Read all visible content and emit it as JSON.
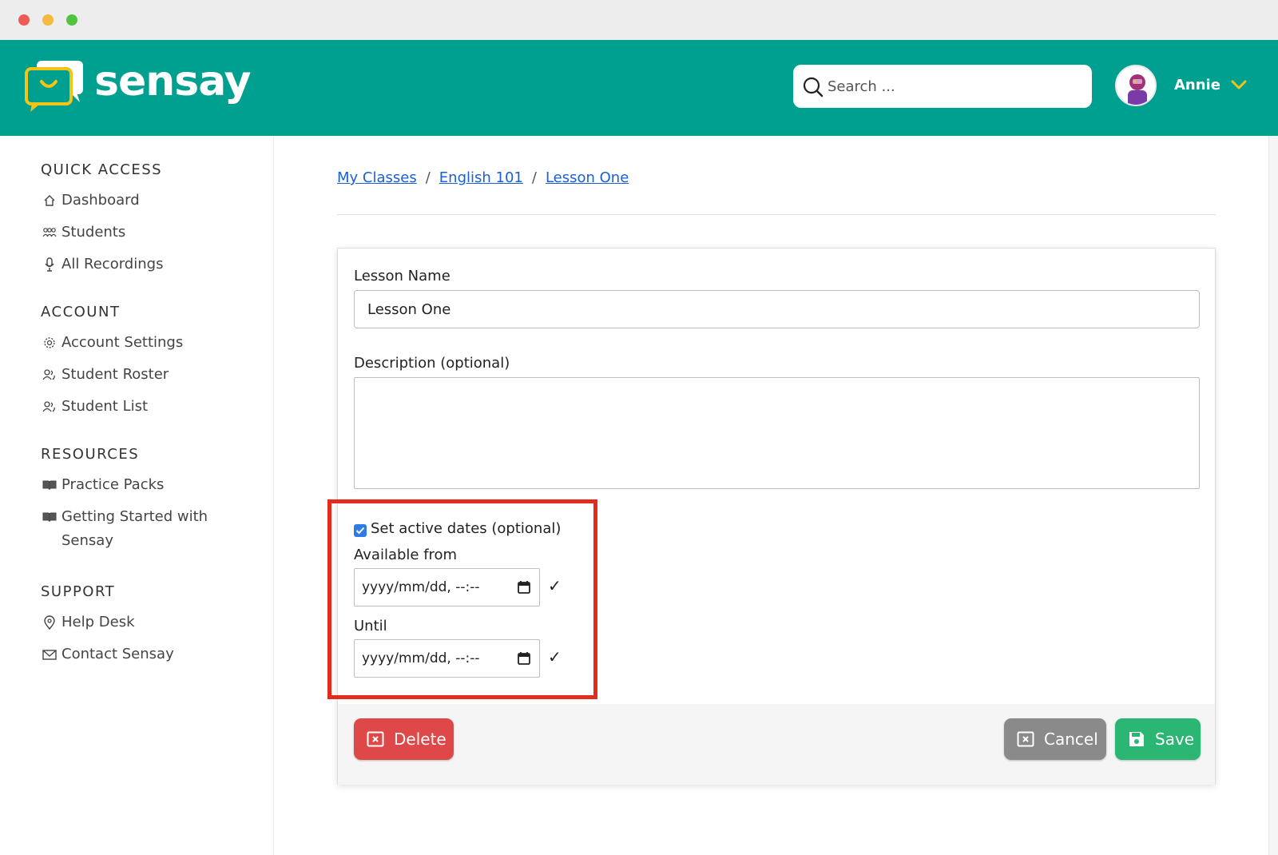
{
  "window": {
    "controls": [
      "close",
      "minimize",
      "maximize"
    ]
  },
  "header": {
    "brand": "sensay",
    "search": {
      "placeholder": "Search ...",
      "value": ""
    },
    "user": {
      "name": "Annie"
    }
  },
  "sidebar": {
    "sections": [
      {
        "title": "QUICK ACCESS",
        "items": [
          {
            "label": "Dashboard",
            "icon": "home-icon"
          },
          {
            "label": "Students",
            "icon": "group-icon"
          },
          {
            "label": "All Recordings",
            "icon": "microphone-icon"
          }
        ]
      },
      {
        "title": "ACCOUNT",
        "items": [
          {
            "label": "Account Settings",
            "icon": "gear-icon"
          },
          {
            "label": "Student Roster",
            "icon": "people-icon"
          },
          {
            "label": "Student List",
            "icon": "people-icon"
          }
        ]
      },
      {
        "title": "RESOURCES",
        "items": [
          {
            "label": "Practice Packs",
            "icon": "book-icon"
          },
          {
            "label": "Getting Started with Sensay",
            "icon": "book-icon"
          }
        ]
      },
      {
        "title": "SUPPORT",
        "items": [
          {
            "label": "Help Desk",
            "icon": "location-pin-icon"
          },
          {
            "label": "Contact Sensay",
            "icon": "envelope-icon"
          }
        ]
      }
    ]
  },
  "breadcrumb": [
    {
      "label": "My Classes"
    },
    {
      "label": "English 101"
    },
    {
      "label": "Lesson One"
    }
  ],
  "breadcrumb_separator": "/",
  "form": {
    "lesson_name_label": "Lesson Name",
    "lesson_name_value": "Lesson One",
    "description_label": "Description (optional)",
    "description_value": "",
    "active_dates_label": "Set active dates (optional)",
    "active_dates_checked": true,
    "available_from_label": "Available from",
    "available_from_value": "yyyy/mm/dd, --:--",
    "until_label": "Until",
    "until_value": "yyyy/mm/dd, --:--",
    "confirm_mark": "✓"
  },
  "buttons": {
    "delete": "Delete",
    "cancel": "Cancel",
    "save": "Save"
  },
  "colors": {
    "brand": "#00a091",
    "delete": "#df4848",
    "cancel": "#8a8a8a",
    "save": "#2bb673",
    "highlight": "#e52b1b",
    "link": "#1b5fd6"
  }
}
